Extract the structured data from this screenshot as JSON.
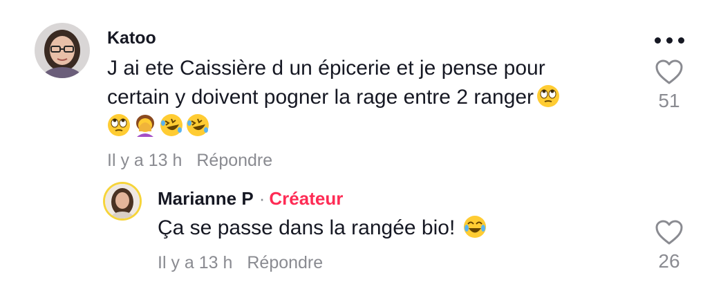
{
  "comments": [
    {
      "username": "Katoo",
      "avatar": "profile-photo-woman-glasses",
      "text_line1": "J ai ete Caissière d un épicerie et je pense pour",
      "text_line2": "certain y doivent pogner la rage entre 2 ranger",
      "emojis": [
        "face-with-rolling-eyes",
        "face-with-rolling-eyes",
        "woman-facepalming",
        "rolling-on-the-floor-laughing",
        "rolling-on-the-floor-laughing"
      ],
      "time": "Il y a 13 h",
      "reply_label": "Répondre",
      "likes": "51"
    }
  ],
  "reply": {
    "username": "Marianne P",
    "separator": "·",
    "badge": "Créateur",
    "avatar": "profile-photo-woman",
    "text": "Ça se passe dans la rangée bio!",
    "emoji": "face-with-tears-of-joy",
    "time": "Il y a 13 h",
    "reply_label": "Répondre",
    "likes": "26"
  },
  "colors": {
    "text": "#161823",
    "muted": "#8a8b91",
    "creator_badge": "#fe2c55",
    "avatar_ring": "#f6d43a"
  },
  "icons": {
    "more": "more-horizontal-icon",
    "like": "heart-outline-icon"
  }
}
